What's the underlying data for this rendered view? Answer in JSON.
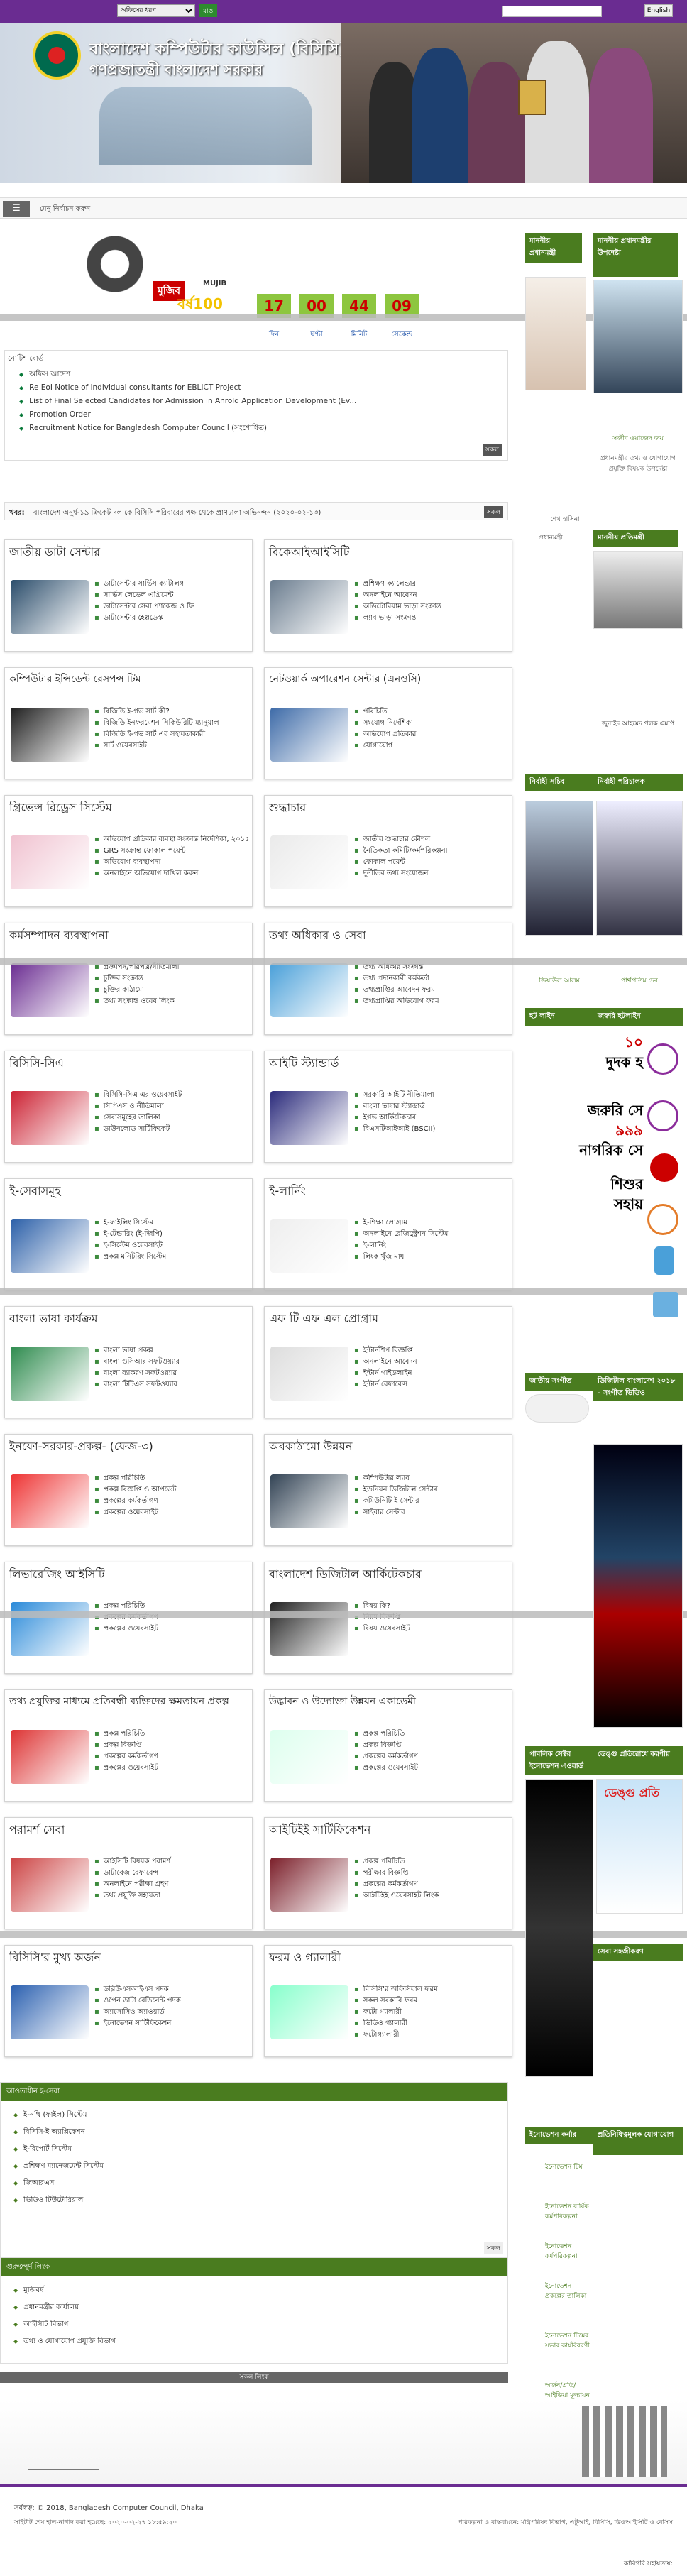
{
  "topbar": {
    "search_select": "অফিসের ধরণ",
    "go": "যাও",
    "lang": "English"
  },
  "banner": {
    "title": "বাংলাদেশ কম্পিউটার কাউন্সিল (বিসিসি)",
    "subtitle": "গণপ্রজাতন্ত্রী বাংলাদেশ সরকার"
  },
  "menu": {
    "label": "মেনু নির্বাচন করুন"
  },
  "mujib": {
    "tag": "মুজিব",
    "years": "বর্ষ100",
    "mark": "MUJIB"
  },
  "countdown": {
    "values": [
      "17",
      "00",
      "44",
      "09"
    ],
    "labels": [
      "দিন",
      "ঘণ্টা",
      "মিনিট",
      "সেকেন্ড"
    ]
  },
  "notice": {
    "head": "নোটিশ বোর্ড",
    "items": [
      "অফিস আদেশ",
      "Re EoI Notice of individual consultants for EBLICT Project",
      "List of Final Selected Candidates for Admission in Anrold Application Development (Ev...",
      "Promotion Order",
      "Recruitment Notice for Bangladesh Computer Council (সংশোধিত)"
    ],
    "all": "সকল"
  },
  "news": {
    "k": "খবর:",
    "v": "বাংলাদেশ অনুর্ধ-১৯ ক্রিকেট দল কে বিসিসি পরিবারের পক্ষ থেকে প্রাণঢালা অভিনন্দন (২০২০-০২-১৩)",
    "all": "সকল"
  },
  "boxes": [
    {
      "title": "জাতীয় ডাটা সেন্টার",
      "items": [
        "ডাটাসেন্টার সার্ভিস ক্যাটালগ",
        "সার্ভিস লেভেল এগ্রিমেন্ট",
        "ডাটাসেন্টার সেবা প্যাকেজ ও ফি",
        "ডাটাসেন্টার হেল্পডেস্ক"
      ]
    },
    {
      "title": "বিকেআইআইসিটি",
      "items": [
        "প্রশিক্ষণ ক্যালেন্ডার",
        "অনলাইনে আবেদন",
        "অডিটোরিয়াম ভাড়া সংক্রান্ত",
        "ল্যাব ভাড়া সংক্রান্ত"
      ]
    },
    {
      "title": "কম্পিউটার ইন্সিডেন্ট রেসপন্স টিম",
      "items": [
        "বিজিডি ই-গভ সার্ট কী?",
        "বিজিডি ইনফরমেশন সিকিউরিটি ম্যানুয়াল",
        "বিজিডি ই-গভ সার্ট এর সহায়তাকারী",
        "সার্ট ওয়েবসাইট"
      ]
    },
    {
      "title": "নেটওয়ার্ক অপারেশন সেন্টার (এনওসি)",
      "items": [
        "পরিচিতি",
        "সংযোগ নির্দেশিকা",
        "অভিযোগ প্রতিকার",
        "যোগাযোগ"
      ]
    },
    {
      "title": "গ্রিভেন্স রিড্রেস সিস্টেম",
      "items": [
        "অভিযোগ প্রতিকার ব্যবস্থা সংক্রান্ত নির্দেশিকা, ২০১৫",
        "GRS সংক্রান্ত ফোকাল পয়েন্ট",
        "অভিযোগ ব্যবস্থাপনা",
        "অনলাইনে অভিযোগ দাখিল করুন"
      ]
    },
    {
      "title": "শুদ্ধাচার",
      "items": [
        "জাতীয় শুদ্ধাচার কৌশল",
        "নৈতিকতা কমিটি/কর্মপরিকল্পনা",
        "ফোকাল পয়েন্ট",
        "দুর্নীতির তথ্য সংযোজন"
      ]
    },
    {
      "title": "কর্মসম্পাদন ব্যবস্থাপনা",
      "items": [
        "প্রজ্ঞাপন/পরিপত্র/নীতিমালা",
        "চুক্তির সংক্রান্ত",
        "চুক্তির কাঠামো",
        "তথ্য সংক্রান্ত ওয়েব লিংক"
      ]
    },
    {
      "title": "তথ্য অধিকার ও সেবা",
      "items": [
        "তথ্য অধিকার সংক্রান্ত",
        "তথ্য প্রদানকারী কর্মকর্তা",
        "তথ্যপ্রাপ্তির আবেদন ফরম",
        "তথ্যপ্রাপ্তির অভিযোগ ফরম"
      ]
    },
    {
      "title": "বিসিসি-সিএ",
      "items": [
        "বিসিসি-সিএ এর ওয়েবসাইট",
        "সিপিএস ও নীতিমালা",
        "সেবাসমূহের তালিকা",
        "ডাউনলোড সার্টিফিকেট"
      ]
    },
    {
      "title": "আইটি স্ট্যান্ডার্ড",
      "items": [
        "সরকারি আইটি নীতিমালা",
        "বাংলা ভাষার স্ট্যান্ডার্ড",
        "ইগভ আর্কিটেকচার",
        "বিএসটিআইআই (BSCII)"
      ]
    },
    {
      "title": "ই-সেবাসমূহ",
      "items": [
        "ই-ফাইলিং সিস্টেম",
        "ই-টেন্ডারিং (ই-জিপি)",
        "ই-সিস্টেম ওয়েবসাইট",
        "প্রকল্প মনিটরিং সিস্টেম"
      ]
    },
    {
      "title": "ই-লার্নিং",
      "items": [
        "ই-শিক্ষা প্রোগ্রাম",
        "অনলাইনে রেজিস্ট্রেশন সিস্টেম",
        "ই-লার্নিং",
        "লিংক খুঁজ মাধ"
      ]
    },
    {
      "title": "বাংলা ভাষা কার্যক্রম",
      "items": [
        "বাংলা ভাষা প্রকল্প",
        "বাংলা ওসিআর সফটওয়্যার",
        "বাংলা ব্যাকরণ সফটওয়্যার",
        "বাংলা টিটিএস সফটওয়্যার"
      ]
    },
    {
      "title": "এফ টি এফ এল প্রোগ্রাম",
      "items": [
        "ইন্টার্নশিপ বিজ্ঞপ্তি",
        "অনলাইনে আবেদন",
        "ইন্টার্ন গাইডলাইন",
        "ইন্টার্ন রেফারেন্স"
      ]
    },
    {
      "title": "ইনফো-সরকার-প্রকল্প- (ফেজ-৩)",
      "items": [
        "প্রকল্প পরিচিতি",
        "প্রকল্প বিজ্ঞপ্তি ও আপডেট",
        "প্রকল্পের কর্মকর্তাগণ",
        "প্রকল্পের ওয়েবসাইট"
      ]
    },
    {
      "title": "অবকাঠামো উন্নয়ন",
      "items": [
        "কম্পিউটার ল্যাব",
        "ইউনিয়ন ডিজিটাল সেন্টার",
        "কমিউনিটি ই সেন্টার",
        "সাইবার সেন্টার"
      ]
    },
    {
      "title": "লিভারেজিং আইসিটি",
      "items": [
        "প্রকল্প পরিচিতি",
        "প্রকল্পের কর্মকর্তাগণ",
        "প্রকল্পের ওয়েবসাইট"
      ]
    },
    {
      "title": "বাংলাদেশ ডিজিটাল আর্কিটেকচার",
      "items": [
        "বিষয় কি?",
        "নিয়ম বিজ্ঞপ্তি",
        "বিষয় ওয়েবসাইট"
      ]
    },
    {
      "title": "তথ্য প্রযুক্তির মাধ্যমে প্রতিবন্ধী ব্যক্তিদের ক্ষমতায়ন প্রকল্প",
      "items": [
        "প্রকল্প পরিচিতি",
        "প্রকল্প বিজ্ঞপ্তি",
        "প্রকল্পের কর্মকর্তাগণ",
        "প্রকল্পের ওয়েবসাইট"
      ]
    },
    {
      "title": "উদ্ভাবন ও উদ্যোক্তা উন্নয়ন একাডেমী",
      "items": [
        "প্রকল্প পরিচিতি",
        "প্রকল্প বিজ্ঞপ্তি",
        "প্রকল্পের কর্মকর্তাগণ",
        "প্রকল্পের ওয়েবসাইট"
      ]
    },
    {
      "title": "পরামর্শ সেবা",
      "items": [
        "আইসিটি বিষয়ক পরামর্শ",
        "ডাটাবেজ রেফারেন্স",
        "অনলাইনে পরীক্ষা গ্রহণ",
        "তথ্য প্রযুক্তি সহায়তা"
      ]
    },
    {
      "title": "আইটিইই সার্টিফিকেশন",
      "items": [
        "প্রকল্প পরিচিতি",
        "পরীক্ষার বিজ্ঞপ্তি",
        "প্রকল্পের কর্মকর্তাগণ",
        "আইটিইই ওয়েবসাইট লিংক"
      ]
    },
    {
      "title": "বিসিসি'র মুখ্য অর্জন",
      "items": [
        "ডব্লিউএসআইএস পদক",
        "ওপেন ডাটা রেডিনেন্ট পদক",
        "অ্যাসোসিও অ্যাওয়ার্ড",
        "ইনোভেশন সার্টিফিকেশন"
      ]
    },
    {
      "title": "ফরম ও গ্যালারী",
      "items": [
        "বিসিসি'র অফিসিয়াল ফরম",
        "সকল সরকারি ফরম",
        "ফটো গ্যালারী",
        "ভিডিও গ্যালারী",
        "ফটোগ্যালারী"
      ]
    }
  ],
  "sidebar": {
    "pm_head": "মাননীয় প্রধানমন্ত্রী",
    "pm2_head": "মাননীয় প্রধানমন্ত্রীর উপদেষ্টা",
    "pm_name": "শেখ হাসিনা",
    "pm_title": "প্রধানমন্ত্রী",
    "adv_name": "সজীব ওয়াজেদ জয়",
    "adv_title": "প্রধানমন্ত্রীর তথ্য ও যোগাযোগ প্রযুক্তি বিষয়ক উপদেষ্টা",
    "min_head": "মাননীয় প্রতিমন্ত্রী",
    "min_name": "জুনাইদ আহমেদ পলক এমপি",
    "sec_head": "নির্বাহী সচিব",
    "dir_head": "নির্বাহী পরিচালক",
    "sec_name": "জিয়াউল আলম",
    "dir_name": "পার্থপ্রতিম দেব",
    "hot_head": "হট লাইন",
    "emer_head": "জরুরি হটলাইন",
    "hot_items": [
      "১০",
      "দুদক হ",
      "জরুরি সে",
      "৯৯৯",
      "নাগরিক সে",
      "শিশুর সহায়"
    ],
    "anthem_head": "জাতীয় সংগীত",
    "video_head": "ডিজিটাল বাংলাদেশ ২০১৮ - সংগীত ভিডিও",
    "pubsvc_head": "পাবলিক সেক্টর ইনোভেশন এওয়ার্ড প্রকল্পর ঝলক",
    "health_head": "ডেঙ্গু প্রতিরোধে করণীয়",
    "dengue": "ডেঙ্গু প্রতি",
    "svc_box": "সেবা সহজীকরণ",
    "innov_head": "ইনোভেশন কর্নার",
    "innov2_head": "প্রতিনিধিত্বমূলক যোগাযোগ",
    "innov_items": [
      "ইনোভেশন টিম",
      "ইনোভেশন বার্ষিক কর্মপরিকল্পনা",
      "ইনোভেশন কর্মপরিকল্পনা",
      "ইনোভেশন প্রকল্পের তালিকা",
      "ইনোভেশন টিমের সভার কার্যবিবরণী",
      "অর্জন/প্রতি/আইডিয়া মূল্যায়ন"
    ]
  },
  "bottom1": {
    "head": "আওতাধীন ই-সেবা",
    "items": [
      "ই-নথি (ফাইল) সিস্টেম",
      "বিসিসি-ই অ্যাপ্লিকেশন",
      "ই-রিপোর্ট সিস্টেম",
      "প্রশিক্ষণ ম্যানেজমেন্ট সিস্টেম",
      "জিআরএস",
      "ভিডিও টিউটোরিয়াল"
    ],
    "all": "সকল"
  },
  "bottom2": {
    "head": "গুরুত্বপূর্ণ লিংক",
    "items": [
      "মুজিবর্ষ",
      "প্রধানমন্ত্রীর কার্যালয়",
      "আইসিটি বিভাগ",
      "তথ্য ও যোগাযোগ প্রযুক্তি বিভাগ"
    ]
  },
  "allsrv": "সকল লিংক",
  "footer": {
    "copy": "সর্বস্বত্ব:",
    "copy_main": "© 2018, Bangladesh Computer Council, Dhaka",
    "update": "সাইটটি শেষ হাল-নাগাদ করা হয়েছে: ২০২০-০২-২৭ ১৮:৫৯:২০",
    "right": "পরিকল্পনা ও বাস্তবায়নে: মন্ত্রিপরিষদ বিভাগ, এটুআই, বিসিসি, ডিওআইসিটি ও বেসিস",
    "tech": "কারিগরি সহায়তায়:"
  }
}
